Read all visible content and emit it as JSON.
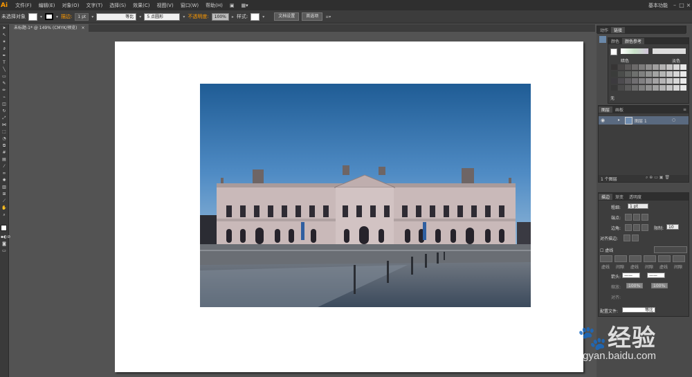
{
  "menu": {
    "logo": "Ai",
    "items": [
      "文件(F)",
      "编辑(E)",
      "对象(O)",
      "文字(T)",
      "选择(S)",
      "效果(C)",
      "视图(V)",
      "窗口(W)",
      "帮助(H)"
    ],
    "workspace": "基本功能"
  },
  "control": {
    "no_selection": "未选择对象",
    "stroke_label": "描边:",
    "stroke_value": "1 pt",
    "stroke_style": "等比",
    "brush": "5 点圆形",
    "opacity_label": "不透明度:",
    "opacity_value": "100%",
    "style_label": "样式:",
    "doc_settings": "文档设置",
    "preferences": "首选项"
  },
  "document": {
    "tab": "未标题-1* @ 149% (CMYK/预览)"
  },
  "panels": {
    "top_tabs": [
      "动作",
      "链接"
    ],
    "color": {
      "tabs": [
        "颜色",
        "颜色参考"
      ],
      "dark_label": "暗色",
      "light_label": "淡色",
      "none_label": "无"
    },
    "layers": {
      "tabs": [
        "图层",
        "画板"
      ],
      "layer_name": "图层 1",
      "count": "1 个图层"
    },
    "stroke": {
      "tabs": [
        "描边",
        "渐变",
        "透明度"
      ],
      "weight_label": "粗细:",
      "weight_value": "1 pt",
      "cap_label": "端点:",
      "corner_label": "边角:",
      "limit_label": "限制:",
      "limit_value": "10",
      "align_label": "对齐描边:",
      "dashed_label": "虚线",
      "dash_labels": [
        "虚线",
        "间隙",
        "虚线",
        "间隙",
        "虚线",
        "间隙"
      ],
      "arrow_label": "箭头:",
      "scale_label": "缩放:",
      "scale_a": "100%",
      "scale_b": "100%",
      "align2_label": "对齐:",
      "profile_label": "配置文件:",
      "profile_value": "等比"
    }
  },
  "watermark": {
    "brand": "Bai",
    "brand2": "经验",
    "url": "jingyan.baidu.com"
  },
  "colors": {
    "accent": "#ff9a00",
    "sky_top": "#1f5c95",
    "sky_bottom": "#8fb6d8"
  }
}
